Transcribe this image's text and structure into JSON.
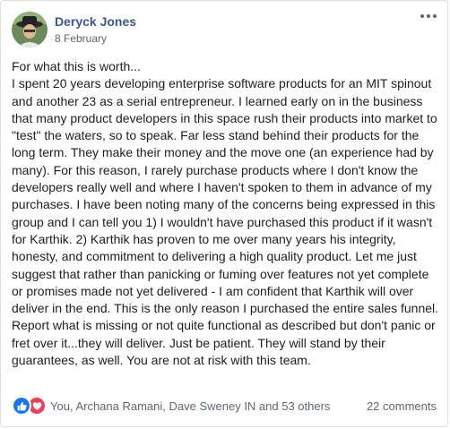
{
  "post": {
    "author": "Deryck Jones",
    "date": "8 February",
    "body": "For what this is worth...\nI spent 20 years developing enterprise software products for an MIT spinout and another 23 as a serial entrepreneur. I learned early on in the business that many product developers in this space rush their products into market to \"test\" the waters, so to speak. Far less stand behind their products for the long term. They make their money and the move one (an experience had by many). For this reason, I rarely purchase products where I don't know the developers really well and where I haven't spoken to them in advance of my purchases. I have been noting many of the concerns being expressed in this group and I can tell you 1) I wouldn't have purchased this product if it wasn't for Karthik. 2) Karthik has proven to me over many years his integrity, honesty, and commitment to delivering a high quality product. Let me just suggest that rather than panicking or fuming over features not yet complete or promises made not yet delivered - I am confident that Karthik will over deliver in the end. This is the only reason I purchased the entire sales funnel. Report what is missing or not quite functional as described but don't panic or fret over it...they will deliver. Just be patient. They will stand by their guarantees, as well. You are not at risk with this team."
  },
  "footer": {
    "reactions_text": "You, Archana Ramani, Dave Sweney IN and 53 others",
    "comments_text": "22 comments",
    "reaction_icons": [
      "like-icon",
      "love-icon"
    ]
  },
  "colors": {
    "author_link": "#385898",
    "like": "#1877f2",
    "love": "#f33e58",
    "secondary_text": "#606770"
  }
}
